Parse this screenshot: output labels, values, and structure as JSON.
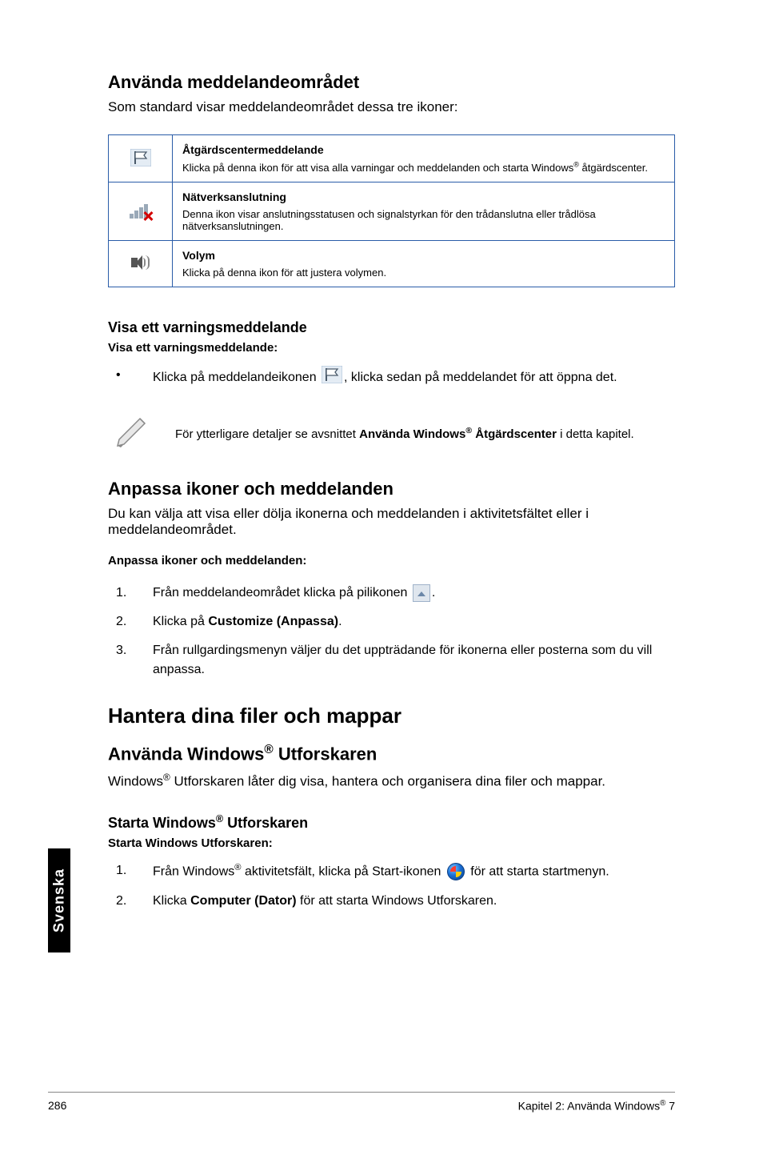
{
  "sideTab": "Svenska",
  "section1": {
    "title": "Använda meddelandeområdet",
    "lead": "Som standard visar meddelandeområdet dessa tre ikoner:"
  },
  "table": {
    "rows": [
      {
        "iconName": "flag-icon",
        "title": "Åtgärdscentermeddelande",
        "desc_pre": "Klicka på denna ikon för att visa alla varningar och meddelanden och starta Windows",
        "desc_post": " åtgärdscenter."
      },
      {
        "iconName": "network-icon",
        "title": "Nätverksanslutning",
        "desc": "Denna ikon visar anslutningsstatusen och signalstyrkan för den trådanslutna eller trådlösa nätverksanslutningen."
      },
      {
        "iconName": "volume-icon",
        "title": "Volym",
        "desc": "Klicka på denna ikon för att justera volymen."
      }
    ]
  },
  "warning": {
    "heading": "Visa ett varningsmeddelande",
    "sub": "Visa ett varningsmeddelande:",
    "bullet_pre": "Klicka på meddelandeikonen ",
    "bullet_post": ", klicka sedan på meddelandet för att öppna det."
  },
  "note": {
    "pre": "För ytterligare detaljer se avsnittet ",
    "bold_pre": "Använda Windows",
    "bold_post": " Åtgärdscenter",
    "post": " i detta kapitel."
  },
  "customize": {
    "heading": "Anpassa ikoner och meddelanden",
    "lead": "Du kan välja att visa eller dölja ikonerna och meddelanden i aktivitetsfältet eller i meddelandeområdet.",
    "sub": "Anpassa ikoner och meddelanden:",
    "step1_pre": "Från meddelandeområdet klicka på pilikonen ",
    "step1_post": ".",
    "step2_pre": "Klicka på ",
    "step2_bold": "Customize (Anpassa)",
    "step2_post": ".",
    "step3": "Från rullgardingsmenyn väljer du det uppträdande för ikonerna eller posterna som du vill anpassa."
  },
  "files": {
    "mainHeading": "Hantera dina filer och mappar",
    "sub1_pre": "Använda Windows",
    "sub1_post": " Utforskaren",
    "lead_pre": "Windows",
    "lead_post": " Utforskaren låter dig visa, hantera och organisera dina filer och mappar.",
    "sub2_pre": "Starta Windows",
    "sub2_post": " Utforskaren",
    "sub3": "Starta Windows Utforskaren:",
    "step1_pre": "Från Windows",
    "step1_mid": " aktivitetsfält, klicka på Start-ikonen ",
    "step1_post": " för att starta startmenyn.",
    "step2_pre": "Klicka ",
    "step2_bold": "Computer (Dator)",
    "step2_post": " för att starta Windows Utforskaren."
  },
  "footer": {
    "pageNum": "286",
    "chapter_pre": "Kapitel 2: Använda Windows",
    "chapter_post": " 7"
  },
  "reg": "®"
}
